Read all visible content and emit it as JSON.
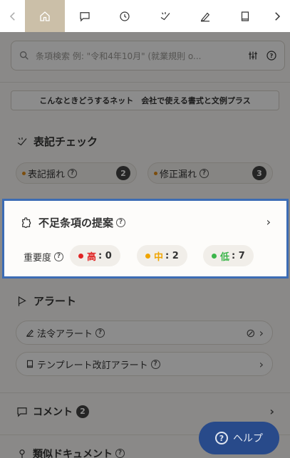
{
  "search": {
    "placeholder": "条項検索 例: \"令和4年10月\" (就業規則 o..."
  },
  "banner": {
    "text": "こんなときどうするネット　会社で使える書式と文例プラス"
  },
  "notation_check": {
    "title": "表記チェック",
    "items": [
      {
        "label": "表記揺れ",
        "count": "2"
      },
      {
        "label": "修正漏れ",
        "count": "3"
      }
    ]
  },
  "missing_clauses": {
    "title": "不足条項の提案",
    "severity_label": "重要度",
    "levels": [
      {
        "label": "高",
        "value": ": 0",
        "color": "#e02424"
      },
      {
        "label": "中",
        "value": ": 2",
        "color": "#f0a500"
      },
      {
        "label": "低",
        "value": ": 7",
        "color": "#3bb54a"
      }
    ]
  },
  "alert": {
    "title": "アラート",
    "items": [
      {
        "label": "法令アラート"
      },
      {
        "label": "テンプレート改訂アラート"
      }
    ]
  },
  "comments": {
    "title": "コメント",
    "count": "2"
  },
  "similar": {
    "title": "類似ドキュメント"
  },
  "help_button": {
    "label": "ヘルプ"
  },
  "colors": {
    "accent": "#3c6cb4",
    "help_bg": "#284a8a",
    "active_tab": "#cbbfa8"
  }
}
